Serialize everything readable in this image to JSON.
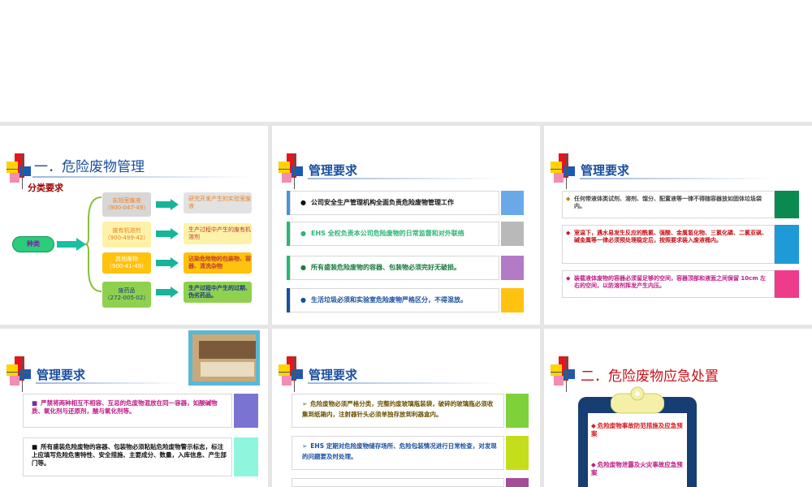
{
  "slide1": {
    "title": "一．危险废物管理",
    "subtitle": "分类要求",
    "root": "种类",
    "items": [
      {
        "name": "实验室废液",
        "code": "（900-047-49）",
        "desc": "研究开发产生的实验室废液"
      },
      {
        "name": "废有机溶剂",
        "code": "（900-499-42）",
        "desc": "生产过程中产生的废有机溶剂"
      },
      {
        "name": "其他废物",
        "code": "（900-41-49）",
        "desc": "沾染危险物的包装物、容器、清洗杂物"
      },
      {
        "name": "废药品",
        "code": "（272-005-02）",
        "desc": "生产过程中产生的过期、伪劣药品。"
      }
    ]
  },
  "slide2": {
    "title": "管理要求",
    "items": [
      "公司安全生产管理机构全面负责危险废物管理工作",
      "EHS 全权负责本公司危险废物的日常监督和对外联络",
      "所有盛装危险废物的容器、包装物必须完好无破损。",
      "生活垃圾必须和实验室危险废物严格区分，不得混放。"
    ]
  },
  "slide3": {
    "title": "管理要求",
    "items": [
      "任何带液体类试剂、溶剂、馏分、配置液等一律不得随容器放如固体垃圾袋内。",
      "室温下，遇水易发生反应的酰氯、强酸、金属氢化物、三氯化磷、二氯亚砜、碱金属等一律必须预处理稳定后，按照要求装入废液桶内。",
      "装载液体废物的容器必须留足够的空间，容器顶部和液面之间保留 10cm 左右的空间，以防溶剂挥发产生内压。"
    ]
  },
  "slide4": {
    "title": "管理要求",
    "items": [
      "严禁将两种相互不相容、互忌的危废物混放在同一容器，如酸碱物质、氧化剂与还原剂，酸与氧化剂等。",
      "所有盛装危险废物的容器、包装物必须粘贴危险废物警示标志，标注上应填写危险危害特性、安全措施、主要成分、数量，入库信息、产生部门等。"
    ]
  },
  "slide5": {
    "title": "管理要求",
    "items": [
      "危险废物必须严格分类，完整的废玻璃瓶装袋，破碎的玻璃瓶必须收集到纸箱内，注射器针头必须单独存放到利器盒内。",
      "EHS 定期对危险废物储存场所、危险包装情况进行日常检查，对发现的问题要及时处理。"
    ]
  },
  "slide6": {
    "title": "二．危险废物应急处置",
    "items": [
      "危险废物事故防范措施及应急预案",
      "危险废物泄露及火灾事故应急预案"
    ]
  },
  "colors": {
    "accent_blue": "#1a4fa0",
    "accent_red": "#c8101a",
    "background": "#e6e6e6"
  }
}
